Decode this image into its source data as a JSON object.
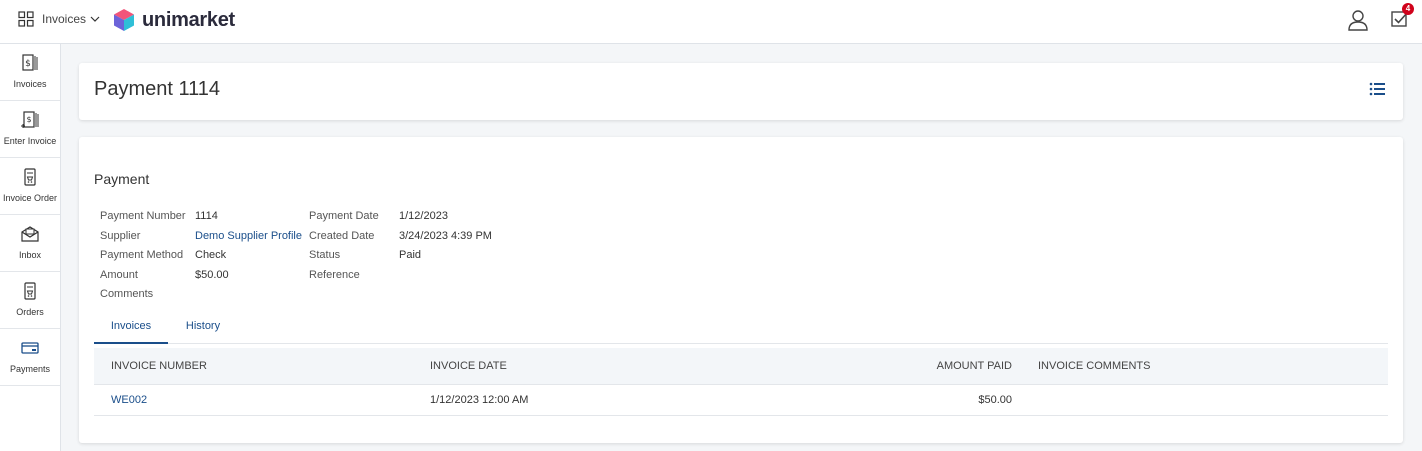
{
  "topbar": {
    "app_switch_label": "Invoices",
    "brand": "unimarket",
    "tasks_badge": "4"
  },
  "sidebar": {
    "items": [
      {
        "label": "Invoices",
        "icon": "invoice-icon"
      },
      {
        "label": "Enter Invoice",
        "icon": "enter-invoice-icon"
      },
      {
        "label": "Invoice Order",
        "icon": "invoice-order-icon"
      },
      {
        "label": "Inbox",
        "icon": "inbox-icon"
      },
      {
        "label": "Orders",
        "icon": "orders-icon"
      },
      {
        "label": "Payments",
        "icon": "payments-icon"
      }
    ]
  },
  "page": {
    "title": "Payment 1114"
  },
  "payment": {
    "section_title": "Payment",
    "fields_left": [
      {
        "label": "Payment Number",
        "value": "1114"
      },
      {
        "label": "Supplier",
        "value": "Demo Supplier Profile"
      },
      {
        "label": "Payment Method",
        "value": "Check"
      },
      {
        "label": "Amount",
        "value": "$50.00"
      },
      {
        "label": "Comments",
        "value": ""
      }
    ],
    "fields_right": [
      {
        "label": "Payment Date",
        "value": "1/12/2023"
      },
      {
        "label": "Created Date",
        "value": "3/24/2023 4:39 PM"
      },
      {
        "label": "Status",
        "value": "Paid"
      },
      {
        "label": "Reference",
        "value": ""
      }
    ]
  },
  "tabs": [
    {
      "label": "Invoices",
      "active": true
    },
    {
      "label": "History",
      "active": false
    }
  ],
  "invoice_table": {
    "headers": [
      "INVOICE NUMBER",
      "INVOICE DATE",
      "AMOUNT PAID",
      "INVOICE COMMENTS"
    ],
    "rows": [
      {
        "number": "WE002",
        "date": "1/12/2023 12:00 AM",
        "amount": "$50.00",
        "comments": ""
      }
    ]
  },
  "colors": {
    "link": "#1a4e8a",
    "badge": "#d0021b"
  }
}
